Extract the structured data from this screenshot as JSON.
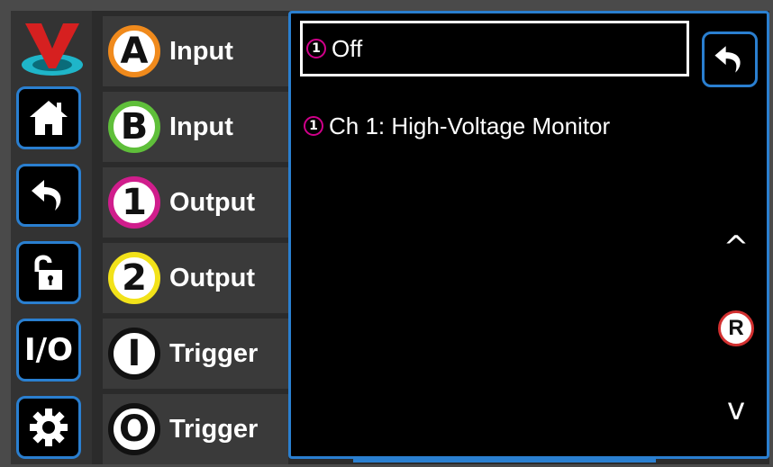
{
  "sidebar": {
    "logo_icon": "v-logo-icon",
    "buttons": [
      {
        "name": "home-icon"
      },
      {
        "name": "back-icon"
      },
      {
        "name": "unlock-icon"
      },
      {
        "name": "io-icon",
        "text": "I/O"
      },
      {
        "name": "gear-icon"
      }
    ]
  },
  "channels": [
    {
      "badge": "A",
      "label": "Input",
      "color": "#f08a1c"
    },
    {
      "badge": "B",
      "label": "Input",
      "color": "#5fbf3a"
    },
    {
      "badge": "1",
      "label": "Output",
      "color": "#d01d8c"
    },
    {
      "badge": "2",
      "label": "Output",
      "color": "#f2e21a"
    },
    {
      "badge": "I",
      "label": "Trigger",
      "color": "#111111"
    },
    {
      "badge": "O",
      "label": "Trigger",
      "color": "#111111"
    }
  ],
  "panel": {
    "options": [
      {
        "num": "1",
        "text": "Off",
        "selected": true
      },
      {
        "num": "1",
        "text": "Ch 1: High-Voltage Monitor",
        "selected": false
      }
    ],
    "scroll_up": "^",
    "scroll_down": "v",
    "reset_label": "R"
  },
  "colors": {
    "accent": "#2a7fd0",
    "option_badge": "#d0008a",
    "reset_ring": "#d23030"
  }
}
